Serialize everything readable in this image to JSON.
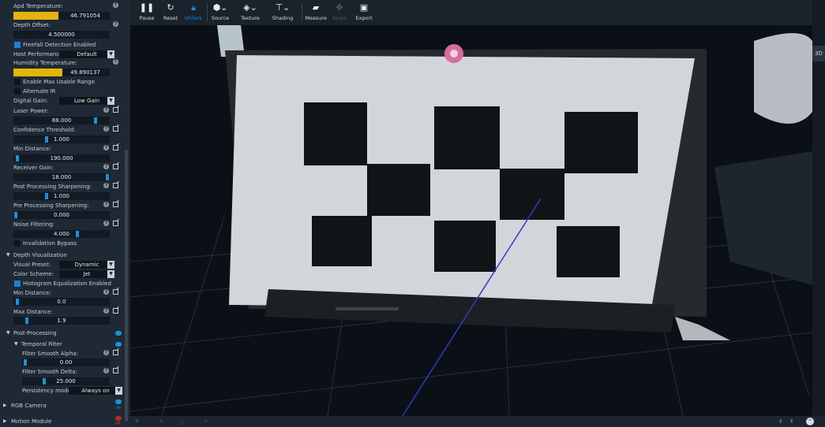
{
  "sidebar": {
    "apd_temperature": {
      "label": "Apd Temperature:",
      "value": "46.791054",
      "fill": 0.47
    },
    "depth_offset": {
      "label": "Depth Offset:",
      "value": "4.500000"
    },
    "freefall": {
      "label": "Freefall Detection Enabled",
      "checked": true
    },
    "host_performance": {
      "label": "Host Performance:",
      "value": "Default"
    },
    "humidity_temperature": {
      "label": "Humidity Temperature:",
      "value": "49.890137",
      "fill": 0.5
    },
    "max_usable_range": {
      "label": "Enable Max Usable Range",
      "checked": false
    },
    "alternate_ir": {
      "label": "Alternate IR",
      "checked": false
    },
    "digital_gain": {
      "label": "Digital Gain:",
      "value": "Low Gain"
    },
    "laser_power": {
      "label": "Laser Power:",
      "value": "88.000",
      "fill": 0.88
    },
    "confidence_threshold": {
      "label": "Confidence Threshold:",
      "value": "1.000",
      "fill": 0.35
    },
    "min_distance": {
      "label": "Min Distance:",
      "value": "190.000",
      "fill": 0.02
    },
    "receiver_gain": {
      "label": "Receiver Gain:",
      "value": "18.000",
      "fill": 0.97
    },
    "post_sharpening": {
      "label": "Post Processing Sharpening:",
      "value": "1.000",
      "fill": 0.35
    },
    "pre_sharpening": {
      "label": "Pre Processing Sharpening:",
      "value": "0.000",
      "fill": 0.02
    },
    "noise_filtering": {
      "label": "Noise Filtering:",
      "value": "4.000",
      "fill": 0.66
    },
    "invalidation_bypass": {
      "label": "Invalidation Bypass",
      "checked": false
    },
    "depth_visualization": {
      "label": "Depth Visualization"
    },
    "visual_preset": {
      "label": "Visual Preset:",
      "value": "Dynamic"
    },
    "color_scheme": {
      "label": "Color Scheme:",
      "value": "Jet"
    },
    "histogram": {
      "label": "Histogram Equalization Enabled",
      "checked": true
    },
    "viz_min_distance": {
      "label": "Min Distance:",
      "value": "0.0",
      "fill": 0.02
    },
    "viz_max_distance": {
      "label": "Max Distance:",
      "value": "1.9",
      "fill": 0.13
    },
    "post_processing": {
      "label": "Post-Processing",
      "enabled": true
    },
    "temporal_filter": {
      "label": "Temporal Filter",
      "enabled": true
    },
    "smooth_alpha": {
      "label": "Filter Smooth Alpha:",
      "value": "0.00",
      "fill": 0.02
    },
    "smooth_delta": {
      "label": "Filter Smooth Delta:",
      "value": "25.000",
      "fill": 0.25
    },
    "persistency": {
      "label": "Persistency mode:",
      "value": "Always on"
    },
    "rgb_camera": {
      "label": "RGB Camera",
      "state": "on"
    },
    "motion_module": {
      "label": "Motion Module",
      "state": "off"
    }
  },
  "toolbar": {
    "pause": "Pause",
    "reset": "Reset",
    "unlock": "Unlock",
    "source": "Source",
    "texture": "Texture",
    "shading": "Shading",
    "measure": "Measure",
    "scale": "Scale",
    "export": "Export"
  },
  "view": {
    "mode_badge": "3D"
  },
  "colors": {
    "accent": "#1a8fe6",
    "slider_fill": "#e3b40c",
    "panel": "#1f2935",
    "toolbar": "#1a222c"
  }
}
